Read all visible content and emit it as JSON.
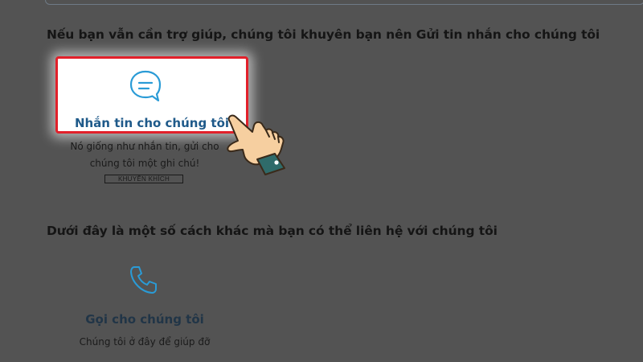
{
  "colors": {
    "overlay_background": "#535353",
    "highlight_border": "#e2202a",
    "link_blue": "#1f5a8a",
    "icon_blue": "#2a9bd6",
    "cuff_teal": "#2f6b6a",
    "skin": "#f6cfa0"
  },
  "section_message": {
    "heading": "Nếu bạn vẫn cần trợ giúp, chúng tôi khuyên bạn nên Gửi tin nhắn cho chúng tôi",
    "card": {
      "icon": "chat-bubble-icon",
      "label": "Nhắn tin cho chúng tôi"
    },
    "description_line1": "Nó giống như nhắn tin, gửi cho",
    "description_line2": "chúng tôi một ghi chú!",
    "badge": "KHUYẾN KHÍCH"
  },
  "section_other": {
    "heading": "Dưới đây là một số cách khác mà bạn có thể liên hệ với chúng tôi",
    "call": {
      "icon": "phone-icon",
      "label": "Gọi cho chúng tôi",
      "description": "Chúng tôi ở đây để giúp đỡ"
    }
  },
  "pointer": {
    "icon": "pointing-hand-icon"
  }
}
